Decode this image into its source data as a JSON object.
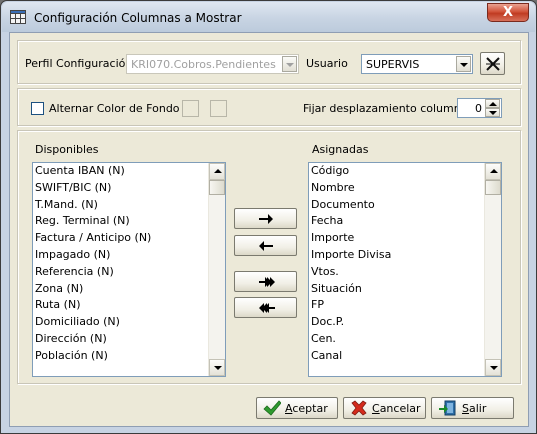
{
  "window": {
    "title": "Configuración Columnas a Mostrar",
    "close_label": "X"
  },
  "config": {
    "perfil_label": "Perfil Configuración",
    "perfil_value": "KRI070.Cobros.Pendientes",
    "usuario_label": "Usuario",
    "usuario_value": "SUPERVIS"
  },
  "options": {
    "alternar_label": "Alternar Color de Fondo",
    "alternar_checked": false,
    "fijar_label": "Fijar desplazamiento columnas:",
    "fijar_value": "0"
  },
  "disponibles": {
    "header": "Disponibles",
    "items": [
      "Cuenta IBAN (N)",
      "SWIFT/BIC (N)",
      "T.Mand. (N)",
      "Reg. Terminal (N)",
      "Factura / Anticipo (N)",
      "Impagado (N)",
      "Referencia (N)",
      "Zona (N)",
      "Ruta (N)",
      "Domiciliado (N)",
      "Dirección (N)",
      "Población (N)"
    ]
  },
  "asignadas": {
    "header": "Asignadas",
    "items": [
      "Código",
      "Nombre",
      "Documento",
      "Fecha",
      "Importe",
      "Importe Divisa",
      "Vtos.",
      "Situación",
      "FP",
      "Doc.P.",
      "Cen.",
      "Canal"
    ]
  },
  "buttons": {
    "accept_first": "A",
    "accept_rest": "ceptar",
    "cancel_first": "C",
    "cancel_rest": "ancelar",
    "exit_first": "S",
    "exit_rest": "alir"
  },
  "icons": {
    "move_right": "arrow-right-icon",
    "move_left": "arrow-left-icon",
    "move_all_right": "double-arrow-right-icon",
    "move_all_left": "double-arrow-left-icon"
  }
}
